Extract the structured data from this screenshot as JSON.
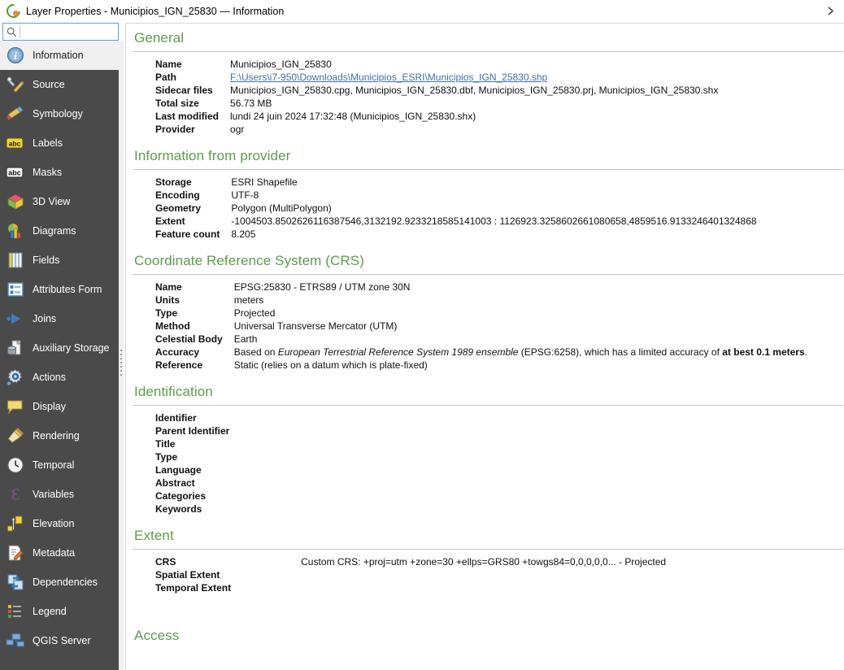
{
  "window": {
    "title": "Layer Properties - Municipios_IGN_25830 — Information",
    "logo_icon": "qgis-logo-icon",
    "close_icon": "close-icon"
  },
  "search": {
    "value": "",
    "placeholder": "",
    "icon": "search-icon"
  },
  "sidebar": {
    "items": [
      {
        "label": "Information",
        "icon": "information-icon",
        "selected": true
      },
      {
        "label": "Source",
        "icon": "source-wrench-icon",
        "selected": false
      },
      {
        "label": "Symbology",
        "icon": "symbology-brush-icon",
        "selected": false
      },
      {
        "label": "Labels",
        "icon": "labels-abc-icon",
        "selected": false
      },
      {
        "label": "Masks",
        "icon": "masks-abc-icon",
        "selected": false
      },
      {
        "label": "3D View",
        "icon": "3d-view-cube-icon",
        "selected": false
      },
      {
        "label": "Diagrams",
        "icon": "diagrams-chart-icon",
        "selected": false
      },
      {
        "label": "Fields",
        "icon": "fields-table-icon",
        "selected": false
      },
      {
        "label": "Attributes Form",
        "icon": "attributes-form-icon",
        "selected": false
      },
      {
        "label": "Joins",
        "icon": "joins-icon",
        "selected": false
      },
      {
        "label": "Auxiliary Storage",
        "icon": "auxiliary-storage-icon",
        "selected": false
      },
      {
        "label": "Actions",
        "icon": "actions-gear-icon",
        "selected": false
      },
      {
        "label": "Display",
        "icon": "display-balloon-icon",
        "selected": false
      },
      {
        "label": "Rendering",
        "icon": "rendering-brush-icon",
        "selected": false
      },
      {
        "label": "Temporal",
        "icon": "temporal-clock-icon",
        "selected": false
      },
      {
        "label": "Variables",
        "icon": "variables-epsilon-icon",
        "selected": false
      },
      {
        "label": "Elevation",
        "icon": "elevation-arrow-icon",
        "selected": false
      },
      {
        "label": "Metadata",
        "icon": "metadata-pencil-icon",
        "selected": false
      },
      {
        "label": "Dependencies",
        "icon": "dependencies-icon",
        "selected": false
      },
      {
        "label": "Legend",
        "icon": "legend-icon",
        "selected": false
      },
      {
        "label": "QGIS Server",
        "icon": "qgis-server-icon",
        "selected": false
      }
    ]
  },
  "general": {
    "heading": "General",
    "rows": [
      {
        "key": "Name",
        "value": "Municipios_IGN_25830"
      },
      {
        "key": "Path",
        "value": "F:\\Users\\i7-950\\Downloads\\Municipios_ESRI\\Municipios_IGN_25830.shp",
        "link": true
      },
      {
        "key": "Sidecar files",
        "value": "Municipios_IGN_25830.cpg, Municipios_IGN_25830.dbf, Municipios_IGN_25830.prj, Municipios_IGN_25830.shx"
      },
      {
        "key": "Total size",
        "value": "56.73 MB"
      },
      {
        "key": "Last modified",
        "value": "lundi 24 juin 2024 17:32:48 (Municipios_IGN_25830.shx)"
      },
      {
        "key": "Provider",
        "value": "ogr"
      }
    ]
  },
  "provider": {
    "heading": "Information from provider",
    "rows": [
      {
        "key": "Storage",
        "value": "ESRI Shapefile"
      },
      {
        "key": "Encoding",
        "value": "UTF-8"
      },
      {
        "key": "Geometry",
        "value": "Polygon (MultiPolygon)"
      },
      {
        "key": "Extent",
        "value": "-1004503.8502626116387546,3132192.9233218585141003 : 1126923.3258602661080658,4859516.9133246401324868"
      },
      {
        "key": "Feature count",
        "value": "8.205"
      }
    ]
  },
  "crs": {
    "heading": "Coordinate Reference System (CRS)",
    "rows": [
      {
        "key": "Name",
        "value": "EPSG:25830 - ETRS89 / UTM zone 30N"
      },
      {
        "key": "Units",
        "value": "meters"
      },
      {
        "key": "Type",
        "value": "Projected"
      },
      {
        "key": "Method",
        "value": "Universal Transverse Mercator (UTM)"
      },
      {
        "key": "Celestial Body",
        "value": "Earth"
      },
      {
        "key": "Reference",
        "value": "Static (relies on a datum which is plate-fixed)"
      }
    ],
    "accuracy": {
      "key": "Accuracy",
      "prefix": "Based on ",
      "italic": "European Terrestrial Reference System 1989 ensemble",
      "middle": " (EPSG:6258), which has a limited accuracy of ",
      "bold": "at best 0.1 meters",
      "suffix": "."
    }
  },
  "identification": {
    "heading": "Identification",
    "rows": [
      {
        "key": "Identifier",
        "value": ""
      },
      {
        "key": "Parent Identifier",
        "value": ""
      },
      {
        "key": "Title",
        "value": ""
      },
      {
        "key": "Type",
        "value": ""
      },
      {
        "key": "Language",
        "value": ""
      },
      {
        "key": "Abstract",
        "value": ""
      },
      {
        "key": "Categories",
        "value": ""
      },
      {
        "key": "Keywords",
        "value": ""
      }
    ]
  },
  "extent": {
    "heading": "Extent",
    "rows": [
      {
        "key": "CRS",
        "value": "Custom CRS: +proj=utm +zone=30 +ellps=GRS80 +towgs84=0,0,0,0,0... - Projected"
      },
      {
        "key": "Spatial Extent",
        "value": ""
      },
      {
        "key": "Temporal Extent",
        "value": ""
      }
    ]
  },
  "access": {
    "heading": "Access"
  },
  "colors": {
    "section_heading": "#5b9e4b",
    "sidebar_bg": "#4a4a4a",
    "link": "#3f6fb0",
    "selection_bg": "#f0f0f0"
  }
}
